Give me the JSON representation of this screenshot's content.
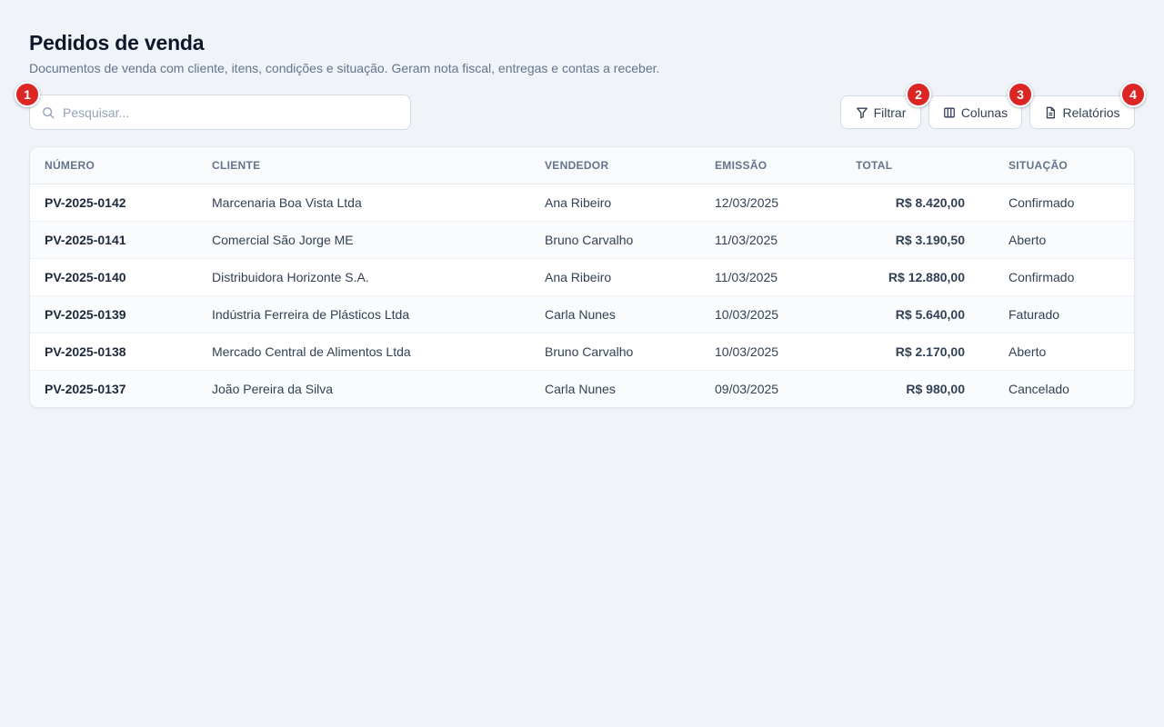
{
  "header": {
    "title": "Pedidos de venda",
    "subtitle": "Documentos de venda com cliente, itens, condições e situação. Geram nota fiscal, entregas e contas a receber."
  },
  "search": {
    "placeholder": "Pesquisar...",
    "value": "",
    "icon": "search-icon"
  },
  "toolbar": {
    "filter_label": "Filtrar",
    "filter_icon": "filter-icon",
    "columns_label": "Colunas",
    "columns_icon": "columns-icon",
    "reports_label": "Relatórios",
    "reports_icon": "document-icon"
  },
  "markers": [
    "1",
    "2",
    "3",
    "4"
  ],
  "table": {
    "columns": [
      "NÚMERO",
      "CLIENTE",
      "VENDEDOR",
      "EMISSÃO",
      "TOTAL",
      "SITUAÇÃO"
    ],
    "rows": [
      {
        "numero": "PV-2025-0142",
        "cliente": "Marcenaria Boa Vista Ltda",
        "vendedor": "Ana Ribeiro",
        "emissao": "12/03/2025",
        "total": "R$ 8.420,00",
        "situacao": "Confirmado"
      },
      {
        "numero": "PV-2025-0141",
        "cliente": "Comercial São Jorge ME",
        "vendedor": "Bruno Carvalho",
        "emissao": "11/03/2025",
        "total": "R$ 3.190,50",
        "situacao": "Aberto"
      },
      {
        "numero": "PV-2025-0140",
        "cliente": "Distribuidora Horizonte S.A.",
        "vendedor": "Ana Ribeiro",
        "emissao": "11/03/2025",
        "total": "R$ 12.880,00",
        "situacao": "Confirmado"
      },
      {
        "numero": "PV-2025-0139",
        "cliente": "Indústria Ferreira de Plásticos Ltda",
        "vendedor": "Carla Nunes",
        "emissao": "10/03/2025",
        "total": "R$ 5.640,00",
        "situacao": "Faturado"
      },
      {
        "numero": "PV-2025-0138",
        "cliente": "Mercado Central de Alimentos Ltda",
        "vendedor": "Bruno Carvalho",
        "emissao": "10/03/2025",
        "total": "R$ 2.170,00",
        "situacao": "Aberto"
      },
      {
        "numero": "PV-2025-0137",
        "cliente": "João Pereira da Silva",
        "vendedor": "Carla Nunes",
        "emissao": "09/03/2025",
        "total": "R$ 980,00",
        "situacao": "Cancelado"
      }
    ]
  },
  "colors": {
    "background": "#f0f3f7",
    "marker": "#dc2626",
    "title": "#0f172a",
    "muted": "#64748b"
  }
}
